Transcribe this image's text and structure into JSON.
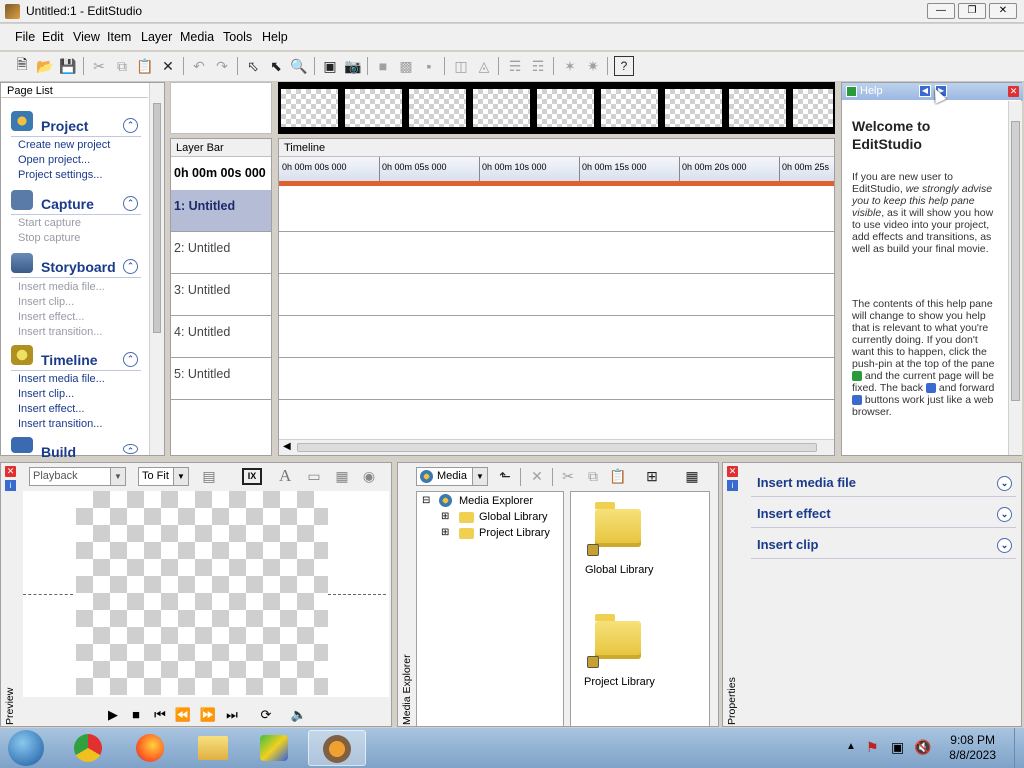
{
  "window": {
    "title": "Untitled:1 - EditStudio"
  },
  "menu": [
    "File",
    "Edit",
    "View",
    "Item",
    "Layer",
    "Media",
    "Tools",
    "Help"
  ],
  "pagelist": {
    "header": "Page List",
    "sections": [
      {
        "title": "Project",
        "items": [
          {
            "label": "Create new project",
            "enabled": true
          },
          {
            "label": "Open project...",
            "enabled": true
          },
          {
            "label": "Project settings...",
            "enabled": true
          }
        ]
      },
      {
        "title": "Capture",
        "items": [
          {
            "label": "Start capture",
            "enabled": false
          },
          {
            "label": "Stop capture",
            "enabled": false
          }
        ]
      },
      {
        "title": "Storyboard",
        "items": [
          {
            "label": "Insert media file...",
            "enabled": false
          },
          {
            "label": "Insert clip...",
            "enabled": false
          },
          {
            "label": "Insert effect...",
            "enabled": false
          },
          {
            "label": "Insert transition...",
            "enabled": false
          }
        ]
      },
      {
        "title": "Timeline",
        "items": [
          {
            "label": "Insert media file...",
            "enabled": true
          },
          {
            "label": "Insert clip...",
            "enabled": true
          },
          {
            "label": "Insert effect...",
            "enabled": true
          },
          {
            "label": "Insert transition...",
            "enabled": true
          }
        ]
      },
      {
        "title": "Build",
        "items": []
      }
    ]
  },
  "layerbar": {
    "header": "Layer Bar",
    "time": "0h 00m 00s 000",
    "layers": [
      "1: Untitled",
      "2: Untitled",
      "3: Untitled",
      "4: Untitled",
      "5: Untitled"
    ],
    "selected_index": 0
  },
  "timeline": {
    "header": "Timeline",
    "ticks": [
      "0h 00m 00s 000",
      "0h 00m 05s 000",
      "0h 00m 10s 000",
      "0h 00m 15s 000",
      "0h 00m 20s 000",
      "0h 00m 25s"
    ]
  },
  "help": {
    "title": "Help",
    "heading": "Welcome to EditStudio",
    "p1_a": "If you are new user to EditStudio, ",
    "p1_em": "we strongly advise you to keep this help pane visible",
    "p1_b": ", as it will show you how to use video into your project, add effects and transitions, as well as build your final movie.",
    "p2_a": "The contents of this help pane will change to show you help that is relevant to what you're currently doing. If you don't want this to happen, click the push-pin at the top of the pane",
    "p2_b": "and the current page will be fixed. The back",
    "p2_c": "and forward",
    "p2_d": "buttons work just like a web browser."
  },
  "preview": {
    "label": "Preview",
    "mode": "Playback",
    "zoom": "To Fit",
    "text_icon_label": "A",
    "ix_label": "IX"
  },
  "media": {
    "label": "Media Explorer",
    "dropdown": "Media",
    "tree_root": "Media Explorer",
    "tree_children": [
      "Global Library",
      "Project Library"
    ],
    "icons": [
      "Global Library",
      "Project Library"
    ]
  },
  "properties": {
    "label": "Properties",
    "rows": [
      "Insert media file",
      "Insert effect",
      "Insert clip"
    ]
  },
  "taskbar": {
    "time": "9:08 PM",
    "date": "8/8/2023",
    "apps": [
      "start-orb",
      "chrome",
      "firefox",
      "file-explorer",
      "bluestacks",
      "editstudio"
    ]
  },
  "colors": {
    "accent": "#1a3a8a",
    "selected_layer": "#b4bcd6",
    "playhead": "#e06030",
    "help_header": "#9cb8e0"
  }
}
